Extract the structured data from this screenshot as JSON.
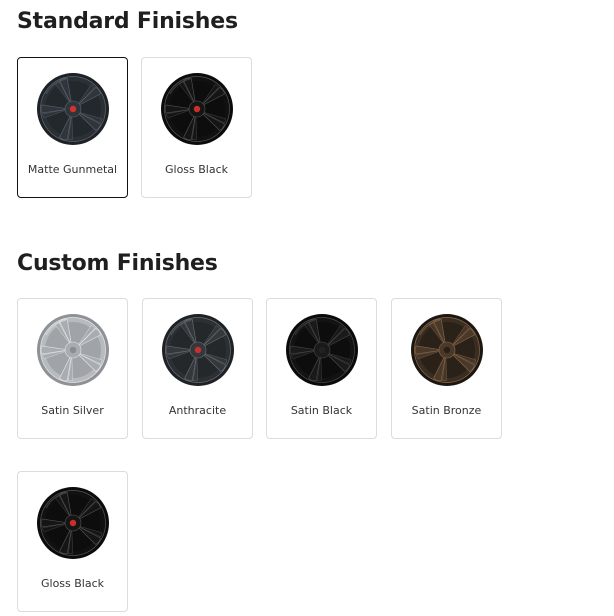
{
  "sections": [
    {
      "title": "Standard Finishes",
      "items": [
        {
          "label": "Matte Gunmetal",
          "selected": true,
          "icon": "wheel-icon",
          "colors": {
            "rim": "#1e2226",
            "face": "#2b3035",
            "spoke": "#2f353b",
            "hi": "#5d666e",
            "cap": "#d0342c"
          }
        },
        {
          "label": "Gloss Black",
          "selected": false,
          "icon": "wheel-icon",
          "colors": {
            "rim": "#0b0b0b",
            "face": "#111111",
            "spoke": "#151515",
            "hi": "#555555",
            "cap": "#c8302a"
          }
        }
      ]
    },
    {
      "title": "Custom Finishes",
      "items": [
        {
          "label": "Satin Silver",
          "selected": false,
          "icon": "wheel-icon",
          "colors": {
            "rim": "#8e9296",
            "face": "#b7bbbf",
            "spoke": "#a9adb1",
            "hi": "#e6e8ea",
            "cap": "#8a8e92"
          }
        },
        {
          "label": "Anthracite",
          "selected": false,
          "icon": "wheel-icon",
          "colors": {
            "rim": "#1f2225",
            "face": "#2c3034",
            "spoke": "#34383c",
            "hi": "#6a7075",
            "cap": "#c8302a"
          }
        },
        {
          "label": "Satin Black",
          "selected": false,
          "icon": "wheel-icon",
          "colors": {
            "rim": "#0a0a0a",
            "face": "#131313",
            "spoke": "#1a1a1a",
            "hi": "#4a4a4a",
            "cap": "#222222"
          }
        },
        {
          "label": "Satin Bronze",
          "selected": false,
          "icon": "wheel-icon",
          "colors": {
            "rim": "#1d1712",
            "face": "#3a2d22",
            "spoke": "#4a3829",
            "hi": "#8a6a4c",
            "cap": "#2a1f17"
          }
        },
        {
          "label": "Gloss Black",
          "selected": false,
          "icon": "wheel-icon",
          "colors": {
            "rim": "#0b0b0b",
            "face": "#111111",
            "spoke": "#151515",
            "hi": "#555555",
            "cap": "#c8302a"
          }
        }
      ]
    }
  ]
}
